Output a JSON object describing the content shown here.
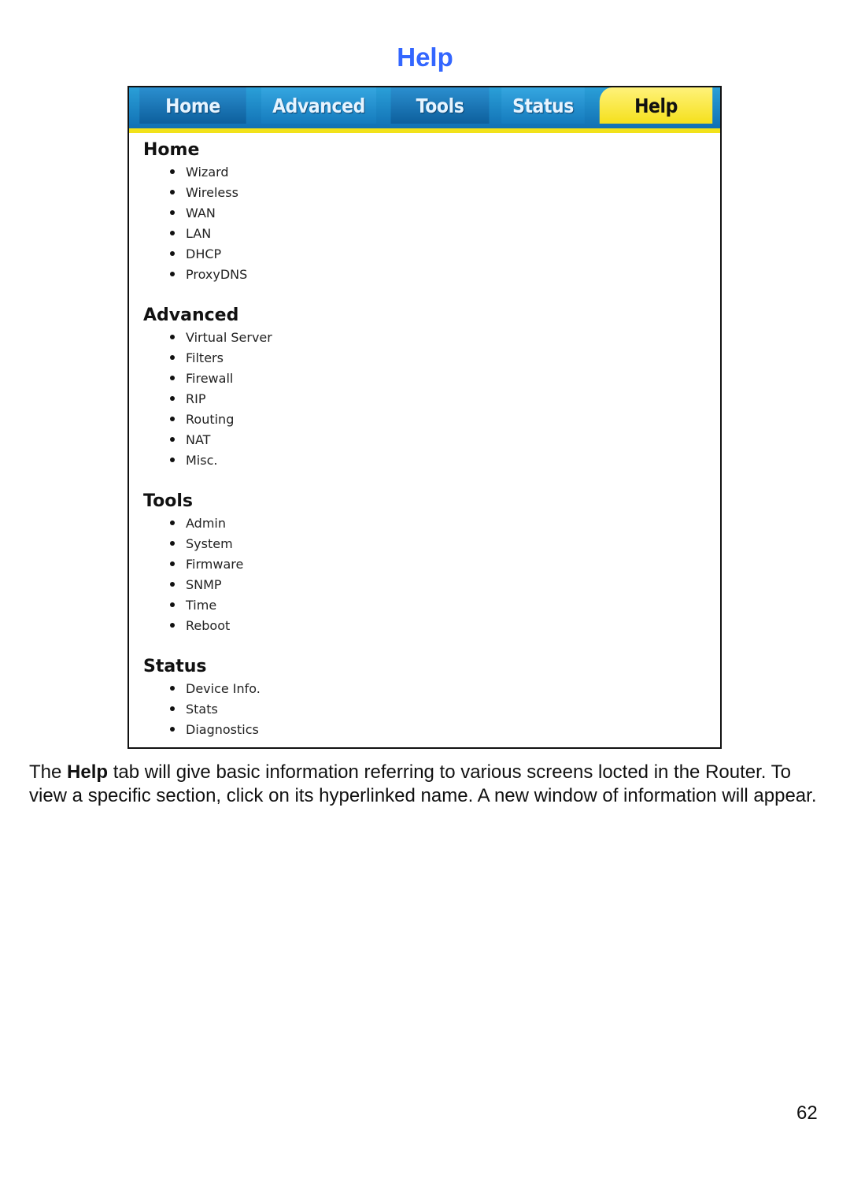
{
  "page": {
    "heading": "Help",
    "page_number": "62"
  },
  "tabs": [
    {
      "label": "Home",
      "active": false
    },
    {
      "label": "Advanced",
      "active": false
    },
    {
      "label": "Tools",
      "active": false
    },
    {
      "label": "Status",
      "active": false
    },
    {
      "label": "Help",
      "active": true
    }
  ],
  "sections": [
    {
      "title": "Home",
      "items": [
        "Wizard",
        "Wireless",
        "WAN",
        "LAN",
        "DHCP",
        "ProxyDNS"
      ]
    },
    {
      "title": "Advanced",
      "items": [
        "Virtual Server",
        "Filters",
        "Firewall",
        "RIP",
        "Routing",
        "NAT",
        "Misc."
      ]
    },
    {
      "title": "Tools",
      "items": [
        "Admin",
        "System",
        "Firmware",
        "SNMP",
        "Time",
        "Reboot"
      ]
    },
    {
      "title": "Status",
      "items": [
        "Device Info.",
        "Stats",
        "Diagnostics"
      ]
    }
  ],
  "description": {
    "prefix": "The ",
    "bold": "Help",
    "rest": " tab will give basic information referring to various screens locted in the Router. To view a specific section, click on its hyperlinked name. A new window of information will appear."
  },
  "colors": {
    "heading": "#3366ff",
    "tab_blue": "#1a84c6",
    "tab_active_yellow": "#f5e01c"
  }
}
